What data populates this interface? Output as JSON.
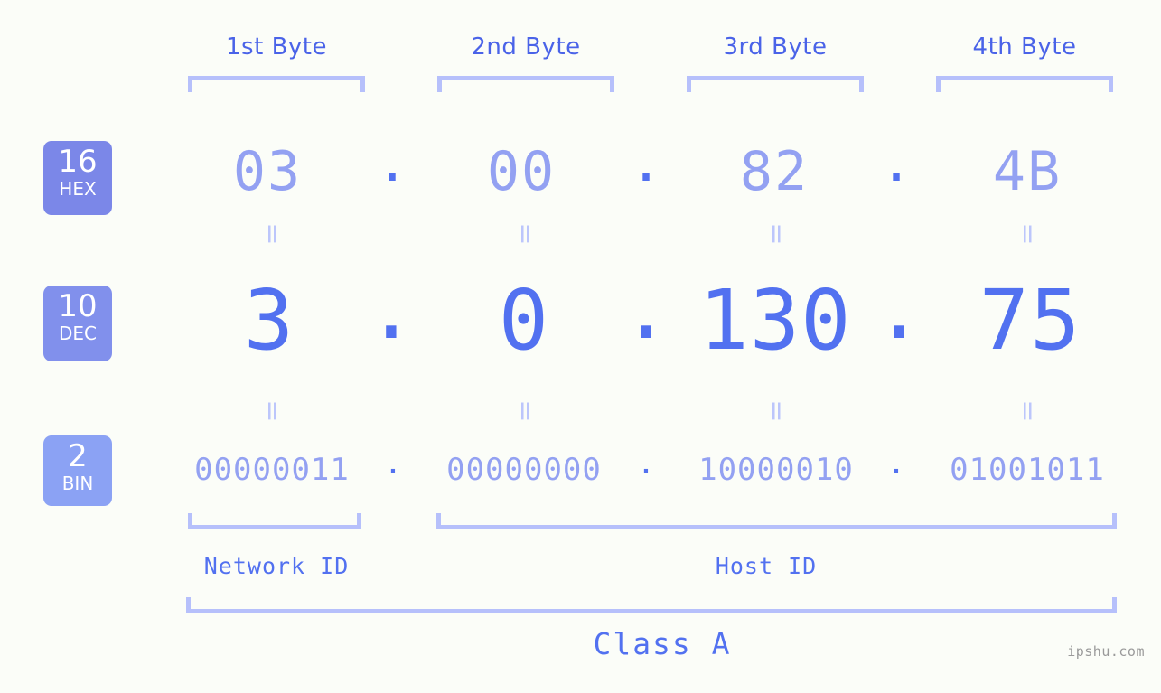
{
  "byte_headers": [
    {
      "label": "1st Byte"
    },
    {
      "label": "2nd Byte"
    },
    {
      "label": "3rd Byte"
    },
    {
      "label": "4th Byte"
    }
  ],
  "rows": {
    "hex": {
      "badge_number": "16",
      "badge_label": "HEX",
      "badge_color": "#7b87e8",
      "values": [
        "03",
        "00",
        "82",
        "4B"
      ],
      "separator": "."
    },
    "dec": {
      "badge_number": "10",
      "badge_label": "DEC",
      "badge_color": "#8190ec",
      "values": [
        "3",
        "0",
        "130",
        "75"
      ],
      "separator": "."
    },
    "bin": {
      "badge_number": "2",
      "badge_label": "BIN",
      "badge_color": "#8ba2f4",
      "values": [
        "00000011",
        "00000000",
        "10000010",
        "01001011"
      ],
      "separator": "."
    }
  },
  "equality_marks": {
    "hex_to_dec": [
      "=",
      "=",
      "=",
      "="
    ],
    "dec_to_bin": [
      "=",
      "=",
      "=",
      "="
    ]
  },
  "id_sections": [
    {
      "label": "Network ID"
    },
    {
      "label": "Host ID"
    }
  ],
  "class": {
    "label": "Class A"
  },
  "watermark": {
    "text": "ipshu.com"
  },
  "colors": {
    "background": "#fbfdf8",
    "bracket": "#b6c0fb",
    "header_text": "#4a63e8",
    "hex_text": "#93a1f2",
    "dec_text": "#5271f0",
    "bin_text": "#93a1f2",
    "dot": "#5271f0",
    "equals": "#bcc6fb",
    "watermark_text": "#9a9a9a"
  }
}
